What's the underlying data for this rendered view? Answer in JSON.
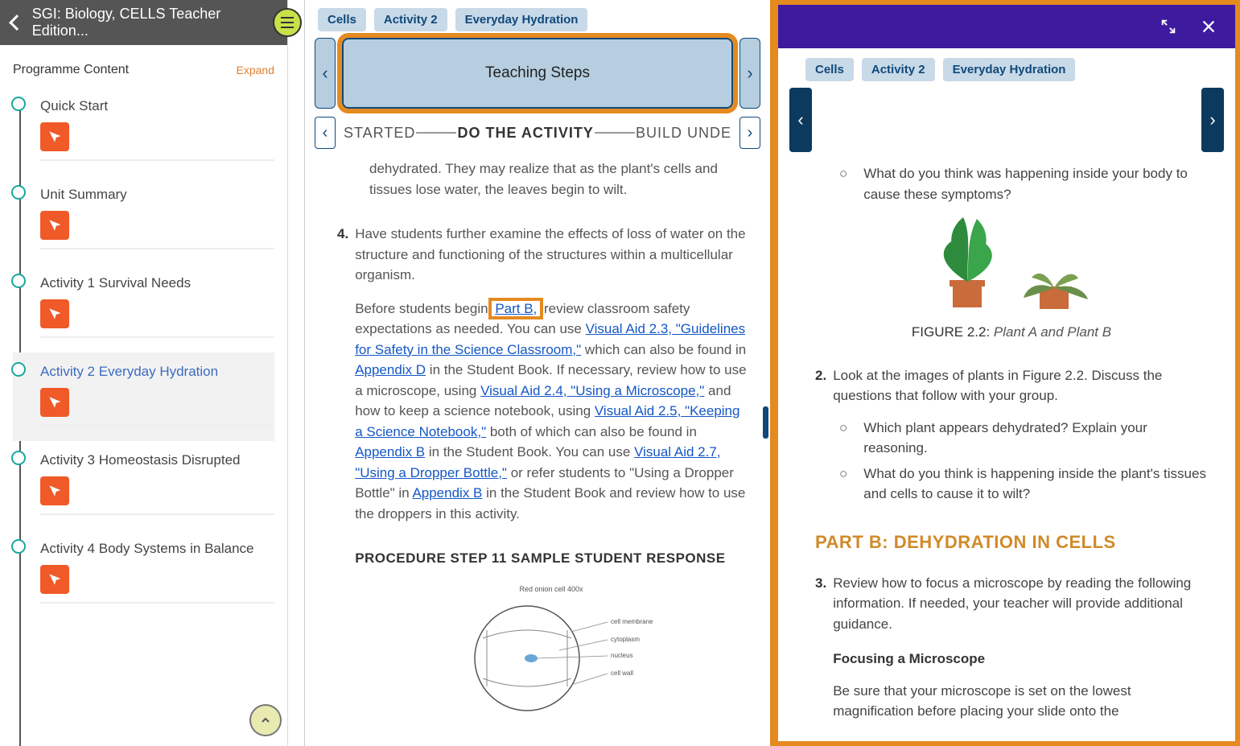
{
  "sidebar": {
    "book_title": "SGI: Biology, CELLS Teacher Edition...",
    "programme_label": "Programme Content",
    "expand_label": "Expand",
    "items": [
      {
        "label": "Quick Start"
      },
      {
        "label": "Unit Summary"
      },
      {
        "label": "Activity 1 Survival Needs"
      },
      {
        "label": "Activity 2 Everyday Hydration"
      },
      {
        "label": "Activity 3 Homeostasis Disrupted"
      },
      {
        "label": "Activity 4 Body Systems in Balance"
      }
    ]
  },
  "middle": {
    "breadcrumbs": [
      "Cells",
      "Activity 2",
      "Everyday Hydration"
    ],
    "teaching_steps_label": "Teaching Steps",
    "phases": {
      "left": "STARTED",
      "center": "DO THE ACTIVITY",
      "right": "BUILD UNDE"
    },
    "para_wilt": "dehydrated. They may realize that as the plant's cells and tissues lose water, the leaves begin to wilt.",
    "step4_num": "4.",
    "step4_intro": "Have students further examine the effects of loss of water on the structure and functioning of the structures within a multicellular organism.",
    "before_begin_1": "Before students begin ",
    "part_b_link": "Part B,",
    "before_begin_2": " review classroom safety expectations as needed. You can use ",
    "va23": "Visual Aid 2.3, \"Guidelines for Safety in the Science Classroom,\"",
    "after_va23": " which can also be found in ",
    "appendix_d": "Appendix D",
    "after_appd": " in the Student Book. If necessary, review how to use a microscope, using ",
    "va24": "Visual Aid 2.4, \"Using a Microscope,\"",
    "after_va24": " and how to keep a science notebook, using ",
    "va25": "Visual Aid 2.5, \"Keeping a Science Notebook,\"",
    "after_va25": " both of which can also be found in ",
    "appendix_b": "Appendix B",
    "after_appb": " in the Student Book. You can use ",
    "va27": "Visual Aid 2.7, \"Using a Dropper Bottle,\"",
    "after_va27": " or refer students to \"Using a Dropper Bottle\" in ",
    "appendix_b2": "Appendix B",
    "after_appb2": " in the Student Book and review how to use the droppers in this activity.",
    "sample_heading": "PROCEDURE STEP 11 SAMPLE STUDENT RESPONSE",
    "diagram_caption": "Red onion cell 400x",
    "diagram_labels": [
      "cell membrane",
      "cytoplasm",
      "nucleus",
      "cell wall"
    ]
  },
  "right": {
    "breadcrumbs": [
      "Cells",
      "Activity 2",
      "Everyday Hydration"
    ],
    "q_symptoms": "What do you think was happening inside your body to cause these symptoms?",
    "figure_label": "FIGURE 2.2: ",
    "figure_italic": "Plant A and Plant B",
    "step2_num": "2.",
    "step2_text": "Look at the images of plants in Figure 2.2. Discuss the questions that follow with your group.",
    "q_which": "Which plant appears dehydrated? Explain your reasoning.",
    "q_inside": "What do you think is happening inside the plant's tissues and cells to cause it to wilt?",
    "part_b_heading": "PART B: DEHYDRATION IN CELLS",
    "step3_num": "3.",
    "step3_text": "Review how to focus a microscope by reading the following information. If needed, your teacher will provide additional guidance.",
    "focus_heading": "Focusing a Microscope",
    "focus_body": "Be sure that your microscope is set on the lowest magnification before placing your slide onto the"
  }
}
